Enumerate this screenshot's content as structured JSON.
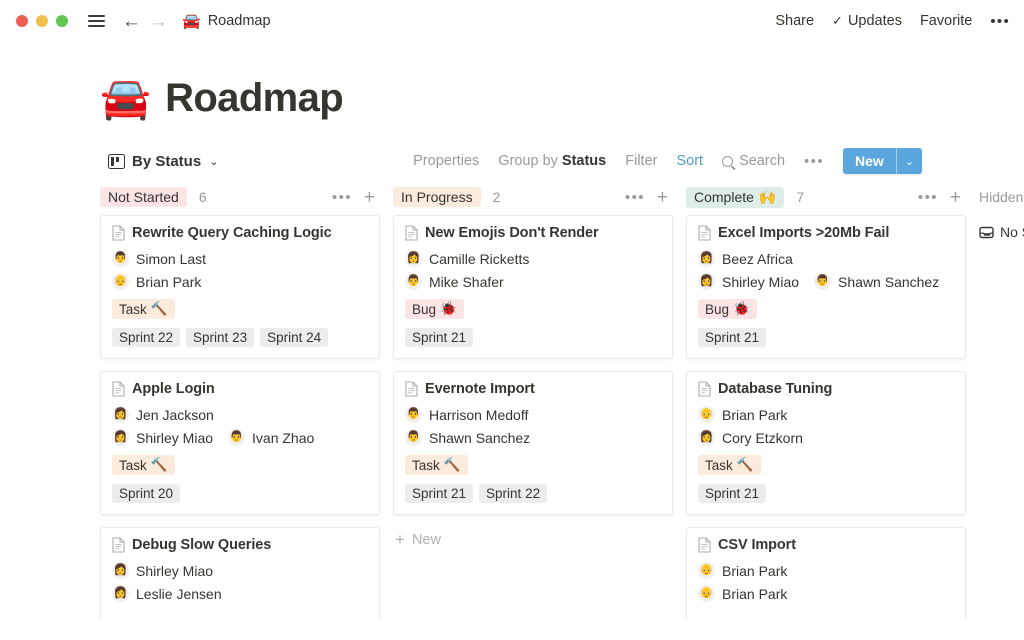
{
  "window": {
    "traffic_lights": [
      "close",
      "minimize",
      "maximize"
    ],
    "menu_icon": "hamburger-icon",
    "back_label": "←",
    "forward_label": "→",
    "breadcrumb_emoji": "🚘",
    "breadcrumb_title": "Roadmap",
    "actions": {
      "share": "Share",
      "updates": "Updates",
      "favorite": "Favorite",
      "more": "•••"
    }
  },
  "page": {
    "emoji": "🚘",
    "title": "Roadmap"
  },
  "toolbar": {
    "view_name": "By Status",
    "view_caret": "⌄",
    "properties": "Properties",
    "group_by_prefix": "Group by ",
    "group_by_value": "Status",
    "filter": "Filter",
    "sort": "Sort",
    "search": "Search",
    "more": "•••",
    "new_label": "New",
    "new_caret": "⌄",
    "accent_color": "#529cca",
    "new_button_color": "#5ba7dd"
  },
  "board": {
    "columns": [
      {
        "status": "Not Started",
        "status_emoji": "",
        "pill_color": "#fbe4e4",
        "count": "6",
        "more": "•••",
        "add": "+",
        "cards": [
          {
            "title": "Rewrite Query Caching Logic",
            "people": [
              [
                {
                  "name": "Simon Last",
                  "avatar": "👨"
                }
              ],
              [
                {
                  "name": "Brian Park",
                  "avatar": "👴"
                }
              ]
            ],
            "type_tag": {
              "label": "Task",
              "emoji": "🔨",
              "kind": "task"
            },
            "sprints": [
              "Sprint 22",
              "Sprint 23",
              "Sprint 24"
            ]
          },
          {
            "title": "Apple Login",
            "people": [
              [
                {
                  "name": "Jen Jackson",
                  "avatar": "👩"
                }
              ],
              [
                {
                  "name": "Shirley Miao",
                  "avatar": "👩"
                },
                {
                  "name": "Ivan Zhao",
                  "avatar": "👨"
                }
              ]
            ],
            "type_tag": {
              "label": "Task",
              "emoji": "🔨",
              "kind": "task"
            },
            "sprints": [
              "Sprint 20"
            ]
          },
          {
            "title": "Debug Slow Queries",
            "people": [
              [
                {
                  "name": "Shirley Miao",
                  "avatar": "👩"
                }
              ],
              [
                {
                  "name": "Leslie Jensen",
                  "avatar": "👩"
                }
              ]
            ],
            "type_tag": null,
            "sprints": []
          }
        ],
        "add_new": null
      },
      {
        "status": "In Progress",
        "status_emoji": "",
        "pill_color": "#faebdd",
        "count": "2",
        "more": "•••",
        "add": "+",
        "cards": [
          {
            "title": "New Emojis Don't Render",
            "people": [
              [
                {
                  "name": "Camille Ricketts",
                  "avatar": "👩"
                }
              ],
              [
                {
                  "name": "Mike Shafer",
                  "avatar": "👨"
                }
              ]
            ],
            "type_tag": {
              "label": "Bug",
              "emoji": "🐞",
              "kind": "bug"
            },
            "sprints": [
              "Sprint 21"
            ]
          },
          {
            "title": "Evernote Import",
            "people": [
              [
                {
                  "name": "Harrison Medoff",
                  "avatar": "👨"
                }
              ],
              [
                {
                  "name": "Shawn Sanchez",
                  "avatar": "👨"
                }
              ]
            ],
            "type_tag": {
              "label": "Task",
              "emoji": "🔨",
              "kind": "task"
            },
            "sprints": [
              "Sprint 21",
              "Sprint 22"
            ]
          }
        ],
        "add_new": "New"
      },
      {
        "status": "Complete",
        "status_emoji": "🙌",
        "pill_color": "#ddedea",
        "count": "7",
        "more": "•••",
        "add": "+",
        "cards": [
          {
            "title": "Excel Imports >20Mb Fail",
            "people": [
              [
                {
                  "name": "Beez Africa",
                  "avatar": "👩"
                }
              ],
              [
                {
                  "name": "Shirley Miao",
                  "avatar": "👩"
                },
                {
                  "name": "Shawn Sanchez",
                  "avatar": "👨"
                }
              ]
            ],
            "type_tag": {
              "label": "Bug",
              "emoji": "🐞",
              "kind": "bug"
            },
            "sprints": [
              "Sprint 21"
            ]
          },
          {
            "title": "Database Tuning",
            "people": [
              [
                {
                  "name": "Brian Park",
                  "avatar": "👴"
                }
              ],
              [
                {
                  "name": "Cory Etzkorn",
                  "avatar": "👩"
                }
              ]
            ],
            "type_tag": {
              "label": "Task",
              "emoji": "🔨",
              "kind": "task"
            },
            "sprints": [
              "Sprint 21"
            ]
          },
          {
            "title": "CSV Import",
            "people": [
              [
                {
                  "name": "Brian Park",
                  "avatar": "👴"
                }
              ],
              [
                {
                  "name": "Brian Park",
                  "avatar": "👴"
                }
              ]
            ],
            "type_tag": null,
            "sprints": []
          }
        ],
        "add_new": null
      }
    ],
    "hidden": {
      "label": "Hidden",
      "items": [
        {
          "icon": "tray-icon",
          "label": "No Status"
        }
      ]
    }
  }
}
